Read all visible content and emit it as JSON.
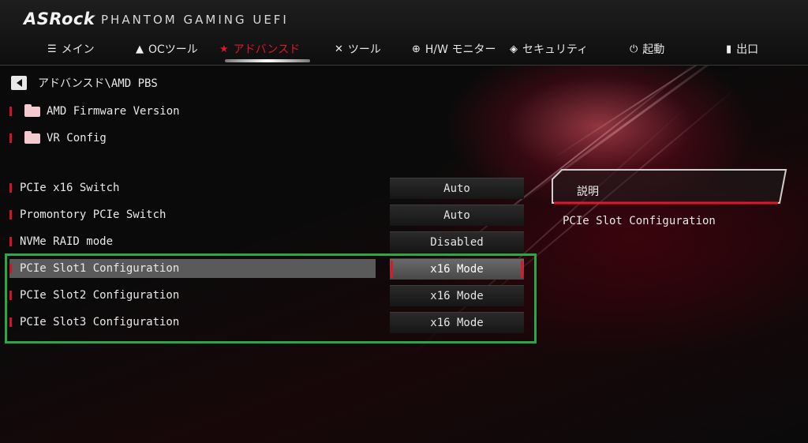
{
  "header": {
    "logo": "ASRock",
    "brand": "PHANTOM GAMING UEFI"
  },
  "tabs": [
    {
      "label": "メイン",
      "icon": "list-icon"
    },
    {
      "label": "OCツール",
      "icon": "rocket-icon"
    },
    {
      "label": "アドバンスド",
      "icon": "star-icon",
      "active": true
    },
    {
      "label": "ツール",
      "icon": "tools-icon"
    },
    {
      "label": "H/W モニター",
      "icon": "crosshair-icon"
    },
    {
      "label": "セキュリティ",
      "icon": "shield-icon"
    },
    {
      "label": "起動",
      "icon": "power-icon"
    },
    {
      "label": "出口",
      "icon": "exit-door-icon"
    }
  ],
  "breadcrumb": "アドバンスド\\AMD PBS",
  "folders": [
    {
      "label": "AMD Firmware Version"
    },
    {
      "label": "VR Config"
    }
  ],
  "settings": [
    {
      "label": "PCIe x16 Switch",
      "value": "Auto"
    },
    {
      "label": "Promontory PCIe Switch",
      "value": "Auto"
    },
    {
      "label": "NVMe RAID mode",
      "value": "Disabled"
    },
    {
      "label": "PCIe Slot1 Configuration",
      "value": "x16 Mode",
      "selected": true
    },
    {
      "label": "PCIe Slot2 Configuration",
      "value": "x16 Mode"
    },
    {
      "label": "PCIe Slot3 Configuration",
      "value": "x16 Mode"
    }
  ],
  "description": {
    "title": "説明",
    "text": "PCIe Slot Configuration"
  },
  "colors": {
    "accent": "#e0162b",
    "highlight_box": "#2aa846",
    "selected_row": "#5a5a5a"
  }
}
